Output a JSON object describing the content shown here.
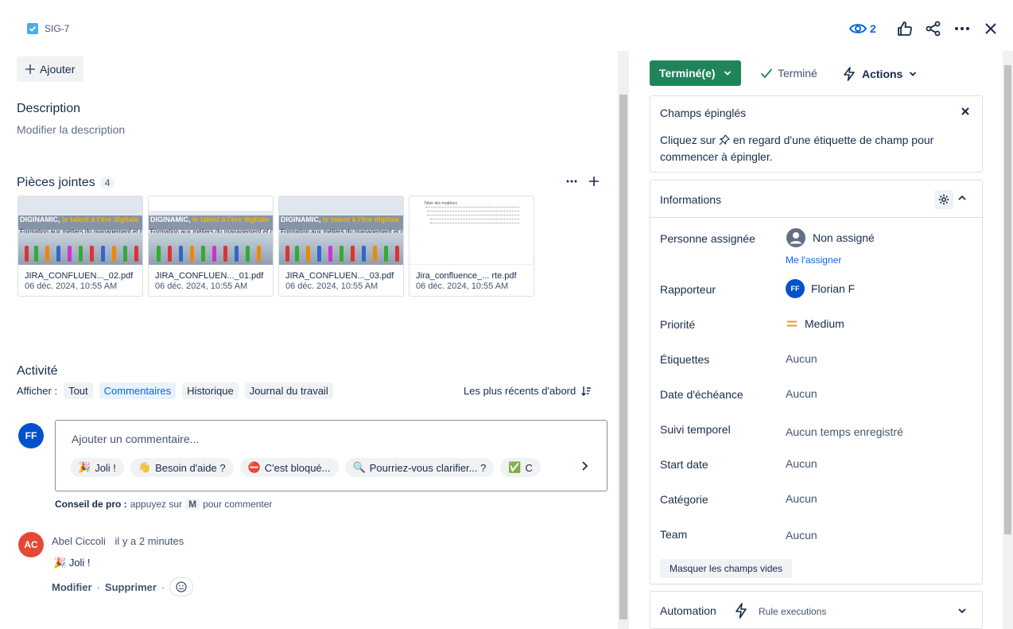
{
  "header": {
    "issue_key": "SIG-7",
    "watchers": "2"
  },
  "left": {
    "add_label": "Ajouter",
    "description": {
      "title": "Description",
      "placeholder": "Modifier la description"
    },
    "attachments": {
      "title": "Pièces jointes",
      "count": "4",
      "items": [
        {
          "name": "JIRA_CONFLUEN..._02.pdf",
          "date": "06 déc. 2024, 10:55 AM",
          "kind": "slide"
        },
        {
          "name": "JIRA_CONFLUEN..._01.pdf",
          "date": "06 déc. 2024, 10:55 AM",
          "kind": "slide"
        },
        {
          "name": "JIRA_CONFLUEN..._03.pdf",
          "date": "06 déc. 2024, 10:55 AM",
          "kind": "slide"
        },
        {
          "name": "Jira_confluence_... rte.pdf",
          "date": "06 déc. 2024, 10:55 AM",
          "kind": "doc"
        }
      ],
      "slide_band_prefix": "DIGINAMIC, ",
      "slide_band_highlight": "le talent à l'ère digitale",
      "slide_band_sub": "Formation aux métiers du management et du web",
      "doc_heading": "Table des matières"
    },
    "activity": {
      "title": "Activité",
      "show_label": "Afficher :",
      "filters": [
        "Tout",
        "Commentaires",
        "Historique",
        "Journal du travail"
      ],
      "selected_filter": "Commentaires",
      "sort_label": "Les plus récents d'abord"
    },
    "comment_box": {
      "avatar": "FF",
      "placeholder": "Ajouter un commentaire...",
      "quick_replies": [
        {
          "emoji": "🎉",
          "label": "Joli !"
        },
        {
          "emoji": "👋",
          "label": "Besoin d'aide ?"
        },
        {
          "emoji": "⛔",
          "label": "C'est bloqué..."
        },
        {
          "emoji": "🔍",
          "label": "Pourriez-vous clarifier... ?"
        },
        {
          "emoji": "✅",
          "label": "C"
        }
      ]
    },
    "protip": {
      "label": "Conseil de pro :",
      "before": "appuyez sur",
      "key": "M",
      "after": "pour commenter"
    },
    "comment": {
      "avatar": "AC",
      "author": "Abel Ciccoli",
      "time": "il y a 2 minutes",
      "emoji": "🎉",
      "body": "Joli !",
      "edit": "Modifier",
      "delete": "Supprimer"
    }
  },
  "right": {
    "status_button": "Terminé(e)",
    "resolution": "Terminé",
    "actions": "Actions",
    "pinned": {
      "title": "Champs épinglés",
      "text_before": "Cliquez sur",
      "text_after": "en regard d'une étiquette de champ pour commencer à épingler."
    },
    "info": {
      "title": "Informations",
      "assignee_label": "Personne assignée",
      "assignee_value": "Non assigné",
      "assign_me": "Me l'assigner",
      "reporter_label": "Rapporteur",
      "reporter_avatar": "FF",
      "reporter_value": "Florian F",
      "priority_label": "Priorité",
      "priority_value": "Medium",
      "labels_label": "Étiquettes",
      "labels_value": "Aucun",
      "due_label": "Date d'échéance",
      "due_value": "Aucun",
      "time_label": "Suivi temporel",
      "time_value": "Aucun temps enregistré",
      "start_label": "Start date",
      "start_value": "Aucun",
      "category_label": "Catégorie",
      "category_value": "Aucun",
      "team_label": "Team",
      "team_value": "Aucun",
      "hide_empty": "Masquer les champs vides"
    },
    "automation": {
      "title": "Automation",
      "subtitle": "Rule executions"
    }
  },
  "colors": {
    "accent": "#0c66e4",
    "status_green": "#1f845a",
    "avatar_ff": "#0052cc",
    "avatar_ac": "#e34935"
  }
}
